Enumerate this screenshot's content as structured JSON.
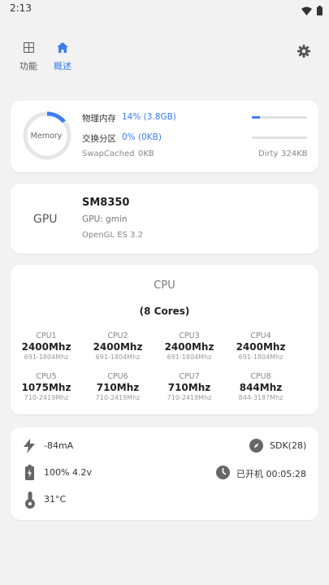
{
  "status": {
    "time": "2:13"
  },
  "tabs": [
    {
      "label": "功能"
    },
    {
      "label": "概述"
    }
  ],
  "memory": {
    "ring_label": "Memory",
    "ring_fraction": 0.14,
    "physical_label": "物理内存",
    "physical_value": "14% (3.8GB)",
    "physical_fraction": 0.14,
    "swap_label": "交换分区",
    "swap_value": "0% (0KB)",
    "swap_fraction": 0.0,
    "swapcached_label": "SwapCached",
    "swapcached_value": "0KB",
    "dirty_label": "Dirty",
    "dirty_value": "324KB"
  },
  "gpu": {
    "title": "GPU",
    "chip": "SM8350",
    "name": "GPU: gmin",
    "opengl": "OpenGL ES 3.2"
  },
  "cpu": {
    "title": "CPU",
    "cores_label": "(8 Cores)",
    "cores": [
      {
        "name": "CPU1",
        "freq": "2400Mhz",
        "range": "691-1804Mhz"
      },
      {
        "name": "CPU2",
        "freq": "2400Mhz",
        "range": "691-1804Mhz"
      },
      {
        "name": "CPU3",
        "freq": "2400Mhz",
        "range": "691-1804Mhz"
      },
      {
        "name": "CPU4",
        "freq": "2400Mhz",
        "range": "691-1804Mhz"
      },
      {
        "name": "CPU5",
        "freq": "1075Mhz",
        "range": "710-2419Mhz"
      },
      {
        "name": "CPU6",
        "freq": "710Mhz",
        "range": "710-2419Mhz"
      },
      {
        "name": "CPU7",
        "freq": "710Mhz",
        "range": "710-2419Mhz"
      },
      {
        "name": "CPU8",
        "freq": "844Mhz",
        "range": "844-3187Mhz"
      }
    ]
  },
  "stats": {
    "current": "-84mA",
    "sdk": "SDK(28)",
    "battery": "100% 4.2v",
    "uptime": "已开机 00:05:28",
    "temperature": "31°C"
  },
  "colors": {
    "accent": "#3d7df0",
    "ring_track": "#e6e6e6"
  },
  "icons": [
    "wifi-icon",
    "battery-icon",
    "grid-icon",
    "home-icon",
    "gear-icon",
    "lightning-icon",
    "compass-icon",
    "battery-charging-icon",
    "clock-icon",
    "thermometer-icon"
  ]
}
